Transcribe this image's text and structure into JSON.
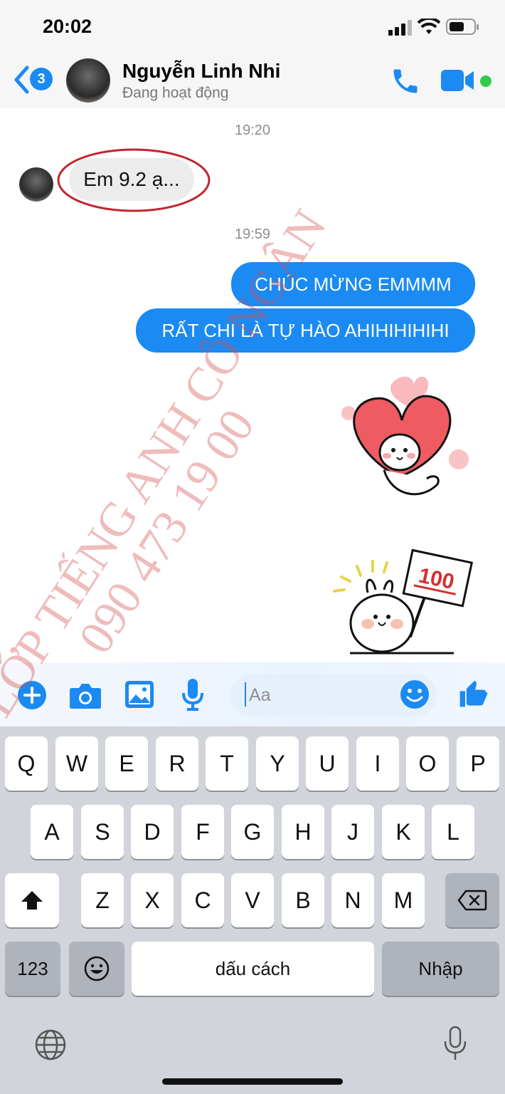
{
  "status_bar": {
    "time": "20:02"
  },
  "header": {
    "back_badge": "3",
    "contact_name": "Nguyễn Linh Nhi",
    "contact_status": "Đang hoạt động"
  },
  "chat": {
    "timestamps": [
      "19:20",
      "19:59"
    ],
    "incoming_message": "Em 9.2 ạ...",
    "outgoing_messages": [
      "CHÚC MỪNG EMMMM",
      "RẤT CHI LÀ TỰ HÀO AHIHIHIHIHI"
    ],
    "sticker_score": "100"
  },
  "composer": {
    "placeholder": "Aa"
  },
  "keyboard": {
    "row1": [
      "Q",
      "W",
      "E",
      "R",
      "T",
      "Y",
      "U",
      "I",
      "O",
      "P"
    ],
    "row2": [
      "A",
      "S",
      "D",
      "F",
      "G",
      "H",
      "J",
      "K",
      "L"
    ],
    "row3": [
      "Z",
      "X",
      "C",
      "V",
      "B",
      "N",
      "M"
    ],
    "numbers_key": "123",
    "space_key": "dấu cách",
    "return_key": "Nhập"
  },
  "watermark": {
    "line1": "LỚP TIẾNG ANH CÔ NGÂN",
    "line2": "090 473 19 00"
  },
  "colors": {
    "accent": "#1b8af2",
    "online": "#31cc46",
    "highlight_circle": "#c0272d"
  }
}
